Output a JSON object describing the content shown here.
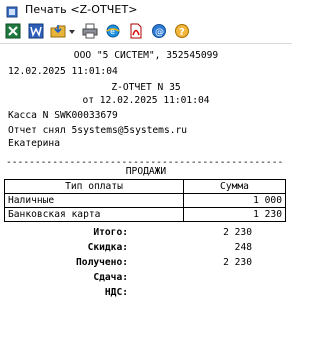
{
  "window": {
    "title": "Печать <Z-ОТЧЕТ>"
  },
  "toolbar": {
    "buttons": [
      "excel-export",
      "word-export",
      "save-export",
      "print",
      "web-export",
      "pdf-export",
      "email",
      "help"
    ]
  },
  "receipt": {
    "company": "ООО \"5 СИСТЕМ\", 352545099",
    "datetime": "12.02.2025 11:01:04",
    "report_title": "Z-ОТЧЕТ N 35",
    "report_date": "от 12.02.2025 11:01:04",
    "register": "Касса N SWK00033679",
    "taken_by": "Отчет снял 5systems@5systems.ru",
    "person": "Екатерина",
    "separator": "------------------------------------------------",
    "sales_header": "ПРОДАЖИ",
    "payments_table": {
      "columns": [
        "Тип оплаты",
        "Сумма"
      ],
      "rows": [
        {
          "type": "Наличные",
          "amount": "1 000"
        },
        {
          "type": "Банковская карта",
          "amount": "1 230"
        }
      ]
    },
    "totals": {
      "total_label": "Итого:",
      "total_value": "2 230",
      "discount_label": "Скидка:",
      "discount_value": "248",
      "received_label": "Получено:",
      "received_value": "2 230",
      "change_label": "Сдача:",
      "change_value": "",
      "vat_label": "НДС:",
      "vat_value": ""
    }
  }
}
